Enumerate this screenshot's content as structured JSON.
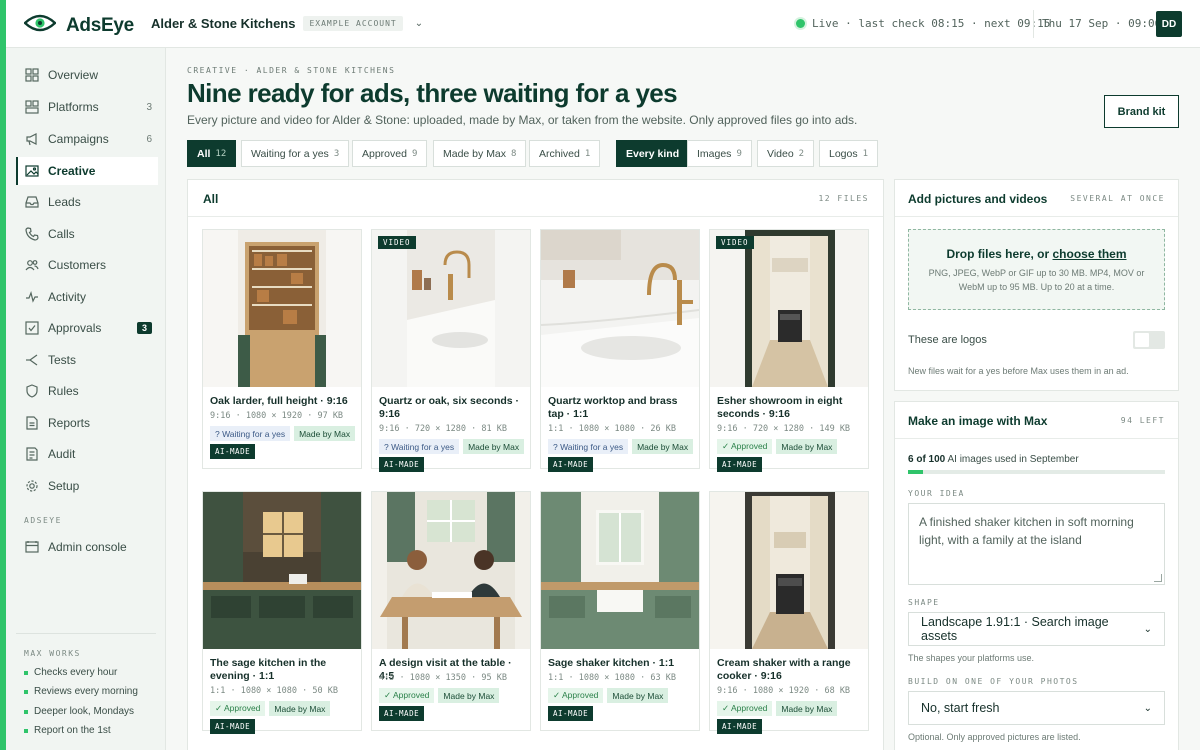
{
  "app": {
    "name": "AdsEye"
  },
  "account": {
    "name": "Alder & Stone Kitchens",
    "tag": "EXAMPLE ACCOUNT"
  },
  "status": {
    "live": "Live · last check 08:15 · next 09:15",
    "clock": "Thu 17 Sep · 09:06",
    "user_initials": "DD"
  },
  "sidebar": {
    "items": [
      {
        "label": "Overview",
        "icon": "grid-icon",
        "count": ""
      },
      {
        "label": "Platforms",
        "icon": "platforms-icon",
        "count": "3"
      },
      {
        "label": "Campaigns",
        "icon": "megaphone-icon",
        "count": "6"
      },
      {
        "label": "Creative",
        "icon": "image-icon",
        "count": ""
      },
      {
        "label": "Leads",
        "icon": "inbox-icon",
        "count": ""
      },
      {
        "label": "Calls",
        "icon": "phone-icon",
        "count": ""
      },
      {
        "label": "Customers",
        "icon": "users-icon",
        "count": ""
      },
      {
        "label": "Activity",
        "icon": "pulse-icon",
        "count": ""
      },
      {
        "label": "Approvals",
        "icon": "check-square-icon",
        "badge": "3"
      },
      {
        "label": "Tests",
        "icon": "split-icon",
        "count": ""
      },
      {
        "label": "Rules",
        "icon": "shield-icon",
        "count": ""
      },
      {
        "label": "Reports",
        "icon": "report-icon",
        "count": ""
      },
      {
        "label": "Audit",
        "icon": "audit-icon",
        "count": ""
      },
      {
        "label": "Setup",
        "icon": "gear-icon",
        "count": ""
      }
    ],
    "section_label": "ADSEYE",
    "admin": {
      "label": "Admin console",
      "icon": "console-icon"
    },
    "works_label": "MAX WORKS",
    "works": [
      "Checks every hour",
      "Reviews every morning",
      "Deeper look, Mondays",
      "Report on the 1st"
    ]
  },
  "header": {
    "crumb": "CREATIVE · ALDER & STONE KITCHENS",
    "title": "Nine ready for ads, three waiting for a yes",
    "subtitle": "Every picture and video for Alder & Stone: uploaded, made by Max, or taken from the website. Only approved files go into ads.",
    "brand_kit": "Brand kit"
  },
  "filters": {
    "status": [
      {
        "label": "All",
        "count": "12"
      },
      {
        "label": "Waiting for a yes",
        "count": "3"
      },
      {
        "label": "Approved",
        "count": "9"
      },
      {
        "label": "Made by Max",
        "count": "8"
      },
      {
        "label": "Archived",
        "count": "1"
      }
    ],
    "kind": [
      {
        "label": "Every kind",
        "count": ""
      },
      {
        "label": "Images",
        "count": "9"
      },
      {
        "label": "Video",
        "count": "2"
      },
      {
        "label": "Logos",
        "count": "1"
      }
    ]
  },
  "grid": {
    "title": "All",
    "count": "12 FILES",
    "cards": [
      {
        "title": "Oak larder, full height · 9:16",
        "meta": "9:16 · 1080 × 1920 · 97 KB",
        "video_label": "",
        "status": "? Waiting for a yes",
        "made_by": "Made by Max",
        "ai": "AI-MADE"
      },
      {
        "title": "Quartz or oak, six seconds · 9:16",
        "meta": "9:16 · 720 × 1280 · 81 KB",
        "video_label": "VIDEO",
        "status": "? Waiting for a yes",
        "made_by": "Made by Max",
        "ai": "AI-MADE"
      },
      {
        "title": "Quartz worktop and brass tap · 1:1",
        "meta": "1:1 · 1080 × 1080 · 26 KB",
        "video_label": "",
        "status": "? Waiting for a yes",
        "made_by": "Made by Max",
        "ai": "AI-MADE"
      },
      {
        "title": "Esher showroom in eight seconds · 9:16",
        "meta": "9:16 · 720 × 1280 · 149 KB",
        "video_label": "VIDEO",
        "status": "✓ Approved",
        "made_by": "Made by Max",
        "ai": "AI-MADE"
      },
      {
        "title": "The sage kitchen in the evening · 1:1",
        "meta": "1:1 · 1080 × 1080 · 50 KB",
        "video_label": "",
        "status": "✓ Approved",
        "made_by": "Made by Max",
        "ai": "AI-MADE"
      },
      {
        "title": "A design visit at the table · 4:5",
        "meta": "4:5 · 1080 × 1350 · 95 KB",
        "video_label": "",
        "status": "✓ Approved",
        "made_by": "Made by Max",
        "ai": "AI-MADE"
      },
      {
        "title": "Sage shaker kitchen · 1:1",
        "meta": "1:1 · 1080 × 1080 · 63 KB",
        "video_label": "",
        "status": "✓ Approved",
        "made_by": "Made by Max",
        "ai": "AI-MADE"
      },
      {
        "title": "Cream shaker with a range cooker · 9:16",
        "meta": "9:16 · 1080 × 1920 · 68 KB",
        "video_label": "",
        "status": "✓ Approved",
        "made_by": "Made by Max",
        "ai": "AI-MADE"
      }
    ]
  },
  "upload": {
    "title": "Add pictures and videos",
    "note": "SEVERAL AT ONCE",
    "drop_main_prefix": "Drop files here, or ",
    "drop_link": "choose them",
    "drop_sub": "PNG, JPEG, WebP or GIF up to 30 MB. MP4, MOV or WebM up to 95 MB. Up to 20 at a time.",
    "logos_label": "These are logos",
    "logos_on": false,
    "footer": "New files wait for a yes before Max uses them in an ad."
  },
  "make": {
    "title": "Make an image with Max",
    "left": "94 LEFT",
    "usage_strong": "6 of 100",
    "usage_rest": " AI images used in September",
    "usage_fraction": 0.06,
    "idea_label": "YOUR IDEA",
    "idea_value": "A finished shaker kitchen in soft morning light, with a family at the island",
    "shape_label": "SHAPE",
    "shape_value": "Landscape 1.91:1 · Search image assets",
    "shape_help": "The shapes your platforms use.",
    "build_label": "BUILD ON ONE OF YOUR PHOTOS",
    "build_value": "No, start fresh",
    "build_help": "Optional. Only approved pictures are listed."
  }
}
